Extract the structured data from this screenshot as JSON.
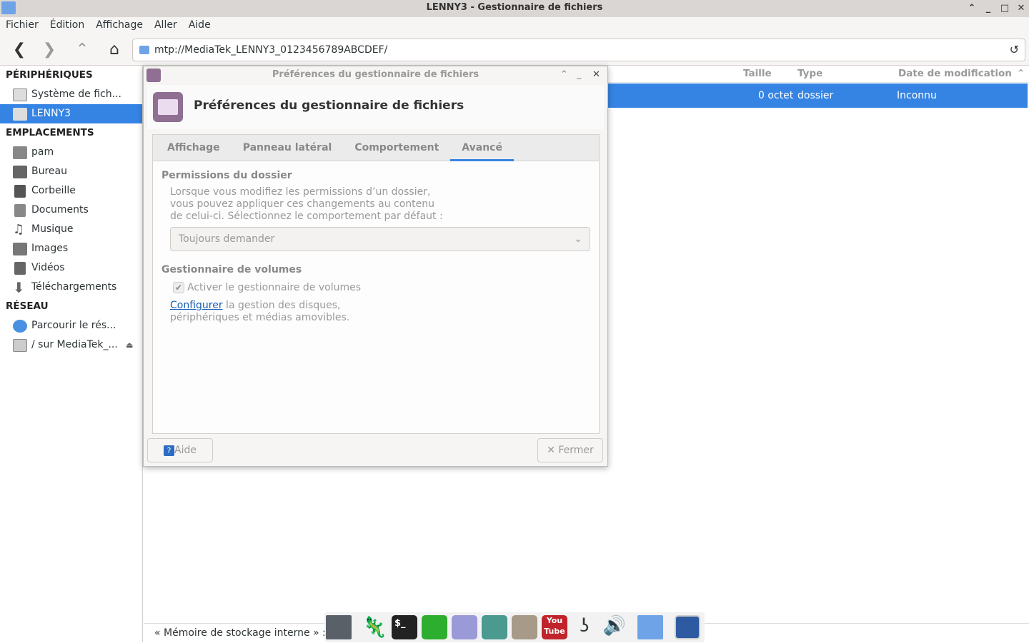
{
  "window": {
    "title": "LENNY3 - Gestionnaire de fichiers",
    "minimize": "_",
    "maximize": "▫",
    "close": "✕",
    "shade": "^"
  },
  "menu": [
    "Fichier",
    "Édition",
    "Affichage",
    "Aller",
    "Aide"
  ],
  "location": "mtp://MediaTek_LENNY3_0123456789ABCDEF/",
  "sidebar": {
    "devices_header": "PÉRIPHÉRIQUES",
    "devices": [
      {
        "label": "Système de fich..."
      },
      {
        "label": "LENNY3"
      }
    ],
    "places_header": "EMPLACEMENTS",
    "places": [
      {
        "label": "pam"
      },
      {
        "label": "Bureau"
      },
      {
        "label": "Corbeille"
      },
      {
        "label": "Documents"
      },
      {
        "label": "Musique"
      },
      {
        "label": "Images"
      },
      {
        "label": "Vidéos"
      },
      {
        "label": "Téléchargements"
      }
    ],
    "network_header": "RÉSEAU",
    "network": [
      {
        "label": "Parcourir le rés..."
      },
      {
        "label": "/ sur MediaTek_..."
      }
    ]
  },
  "list": {
    "columns": {
      "size": "Taille",
      "type": "Type",
      "date": "Date de modification"
    },
    "rows": [
      {
        "size": "0 octet",
        "type": "dossier",
        "date": "Inconnu"
      }
    ]
  },
  "status": "« Mémoire de stockage interne » : do",
  "dialog": {
    "title": "Préférences du gestionnaire de fichiers",
    "heading": "Préférences du gestionnaire de fichiers",
    "tabs": [
      "Affichage",
      "Panneau latéral",
      "Comportement",
      "Avancé"
    ],
    "perm_title": "Permissions du dossier",
    "perm_text": [
      "Lorsque vous modifiez les permissions d’un dossier,",
      "vous pouvez appliquer ces changements au contenu",
      "de celui-ci. Sélectionnez le comportement par défaut :"
    ],
    "perm_select": "Toujours demander",
    "vol_title": "Gestionnaire de volumes",
    "vol_check": "Activer le gestionnaire de volumes",
    "vol_checked": true,
    "configure_link": "Configurer",
    "configure_text1": " la gestion des disques,",
    "configure_text2": "périphériques et médias amovibles.",
    "help": "Aide",
    "close": "✕ Fermer"
  },
  "dock": [
    "terminal-window",
    "chameleon",
    "terminal",
    "spreadsheet",
    "text-editor",
    "web-browser",
    "gimp",
    "youtube",
    "audio-plug",
    "volume",
    "file-manager",
    "screenshot"
  ]
}
